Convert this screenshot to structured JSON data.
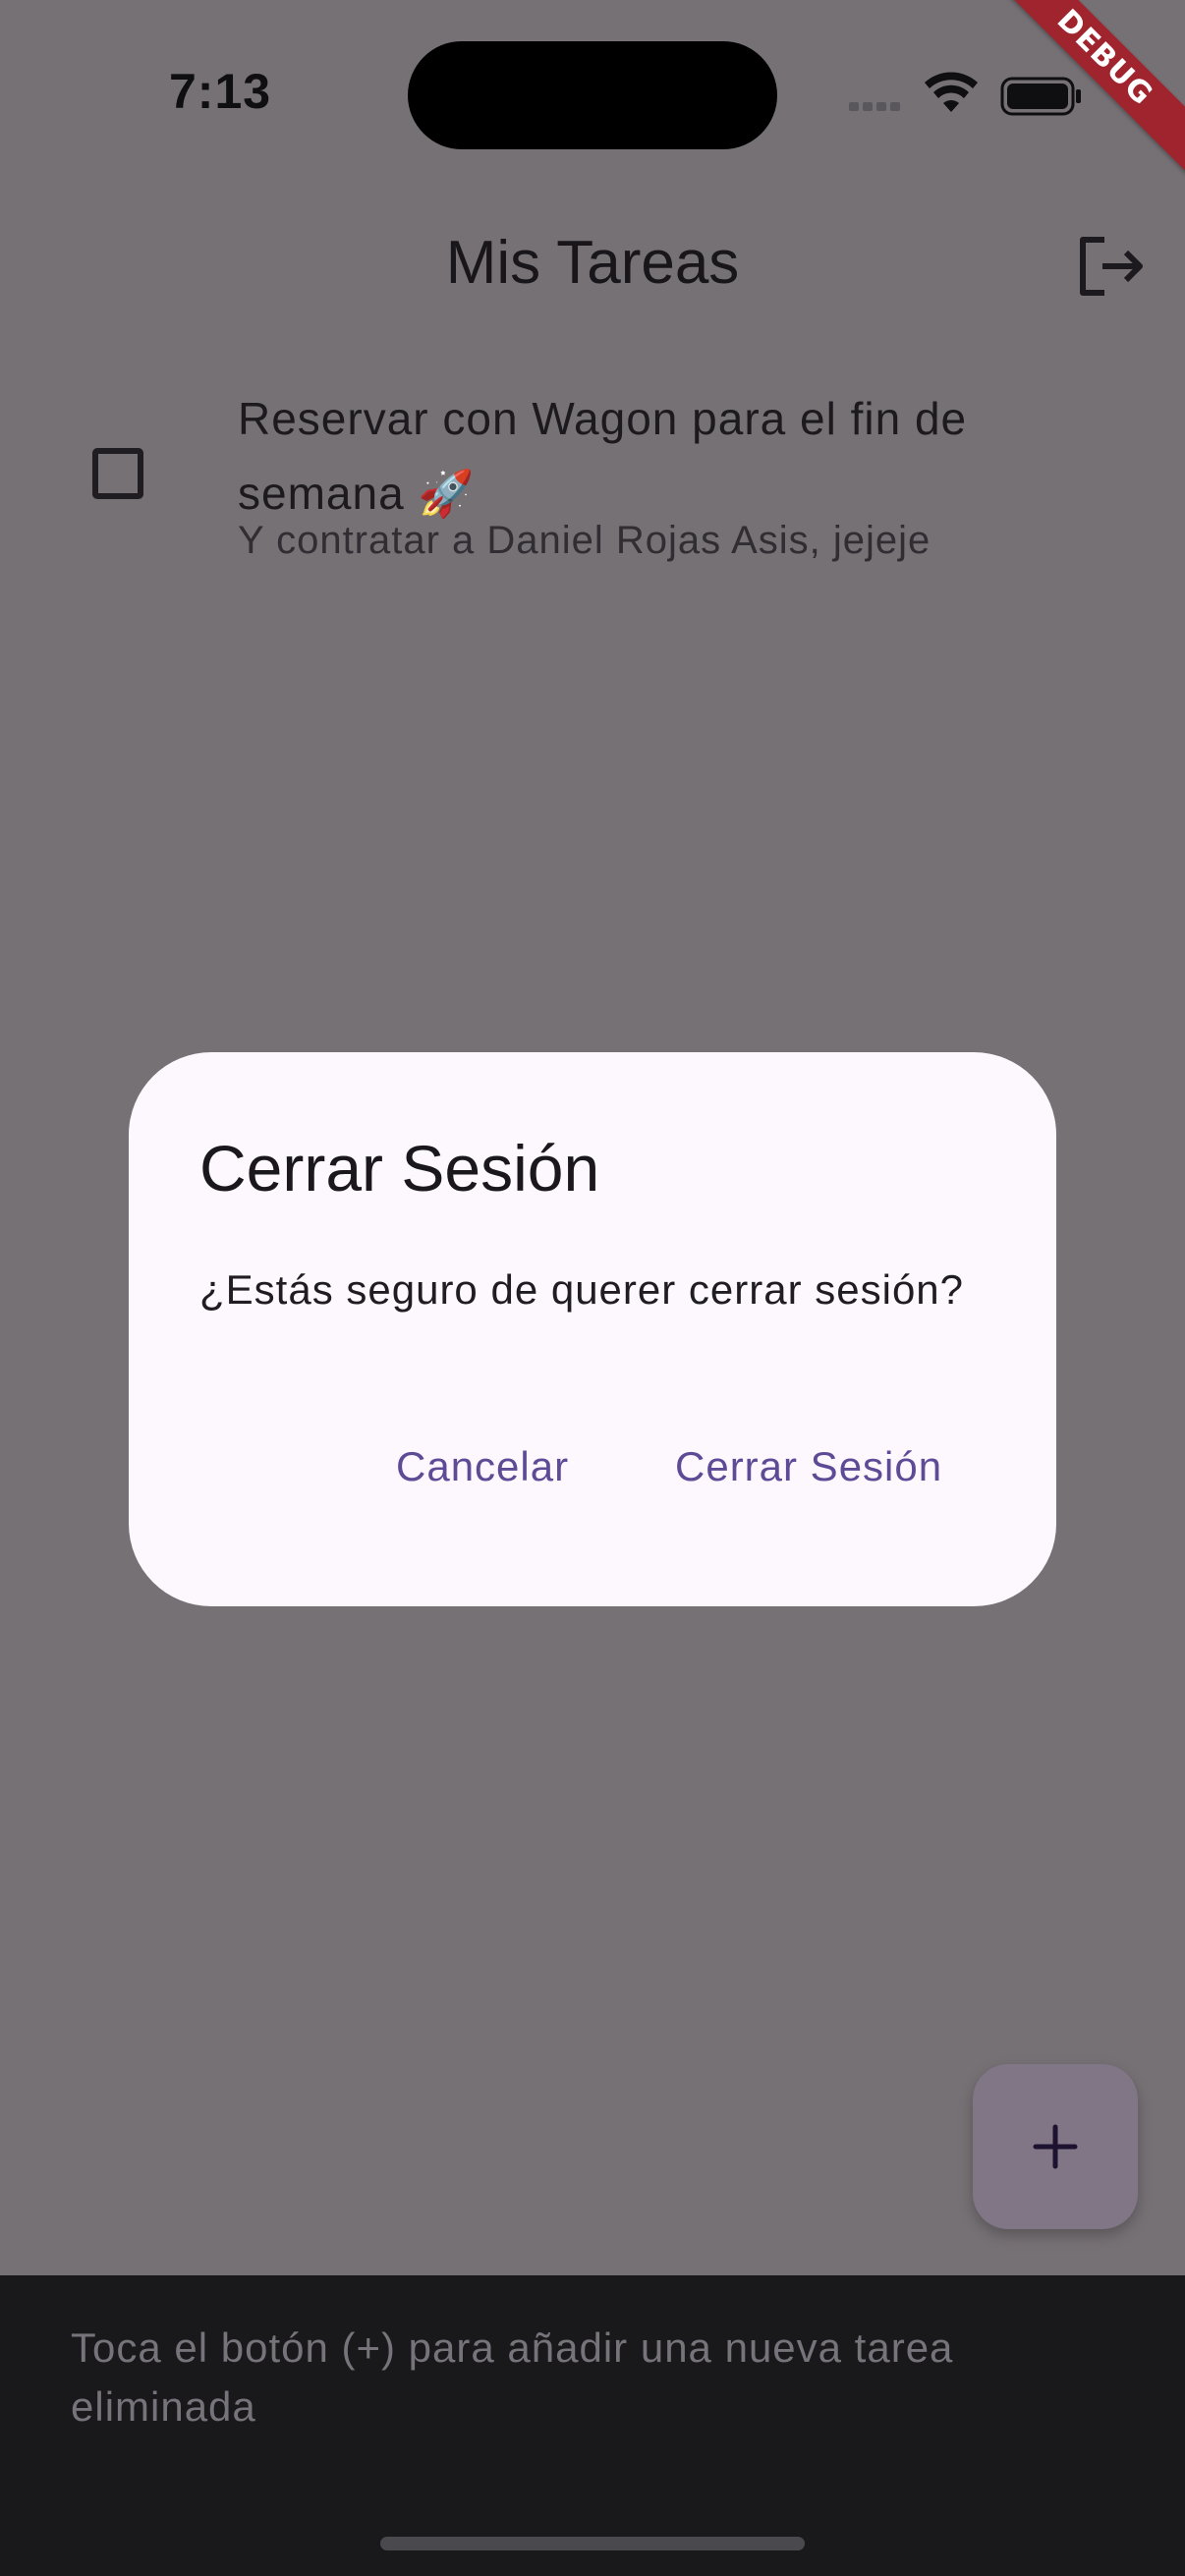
{
  "status_bar": {
    "time": "7:13",
    "icons": [
      "signal-dots-icon",
      "wifi-icon",
      "battery-icon"
    ]
  },
  "debug_banner": "DEBUG",
  "app_bar": {
    "title": "Mis Tareas",
    "action_icon": "logout-icon"
  },
  "tasks": [
    {
      "title": "Reservar con Wagon para el fin de semana 🚀",
      "subtitle": "Y contratar a Daniel Rojas Asis, jejeje",
      "completed": false
    }
  ],
  "fab": {
    "icon": "plus-icon"
  },
  "snackbar": {
    "message": "Toca el botón (+) para añadir una nueva tarea eliminada"
  },
  "dialog": {
    "title": "Cerrar Sesión",
    "body": "¿Estás seguro de querer cerrar sesión?",
    "cancel_label": "Cancelar",
    "confirm_label": "Cerrar Sesión"
  },
  "colors": {
    "scrim_background": "#767175",
    "dialog_surface": "#fdf7fe",
    "dialog_action": "#5e4b96",
    "snackbar_background": "#19181b",
    "debug_banner": "#a0242e"
  }
}
